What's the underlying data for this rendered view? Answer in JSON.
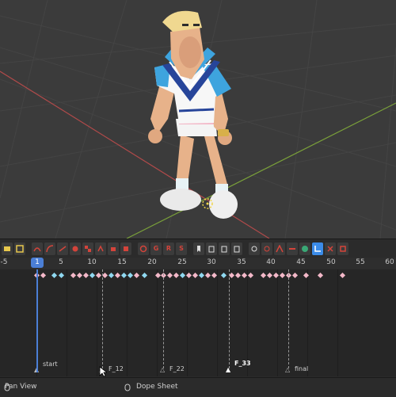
{
  "timeline": {
    "ruler_ticks": [
      "-5",
      "5",
      "10",
      "15",
      "20",
      "25",
      "30",
      "35",
      "40",
      "45",
      "50",
      "55",
      "60"
    ],
    "current_frame": "1",
    "markers": [
      "start",
      "F_12",
      "F_22",
      "F_33",
      "final"
    ]
  },
  "status": {
    "left_label": "Pan View",
    "center_label": "Dope Sheet"
  },
  "icons": [
    "keying-set-icon",
    "select-icon",
    "curve-tool-icon",
    "interpolation-icon",
    "key-icon",
    "record-icon",
    "snap-icon",
    "ghost-icon",
    "marker-icon",
    "copy-icon",
    "paste-icon",
    "delete-icon",
    "filter-icon",
    "link-icon",
    "view-icon",
    "settings-icon"
  ],
  "colors": {
    "accent": "#4b7fd6",
    "keyframe_pink": "#f3b8c8",
    "keyframe_cyan": "#8fd8f0",
    "toolbar_red": "#d4443b",
    "toolbar_yellow": "#e8c84c",
    "toolbar_blue": "#3b8be8"
  }
}
